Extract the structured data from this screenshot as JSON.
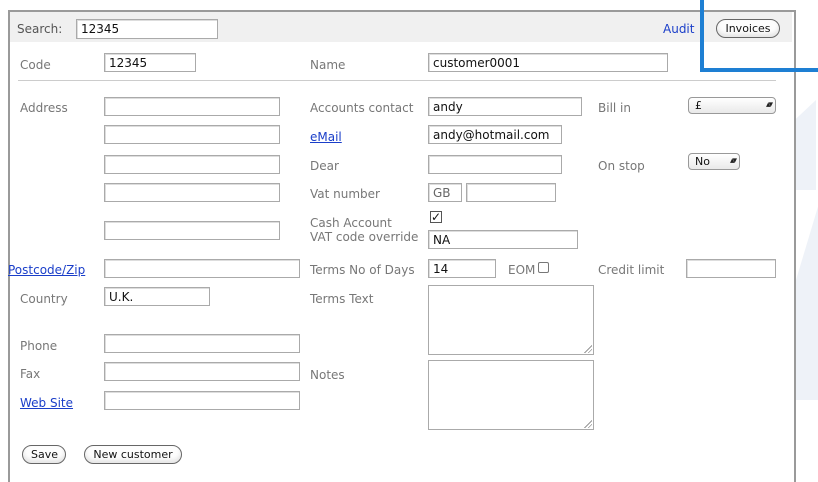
{
  "header": {
    "search_label": "Search:",
    "search_value": "12345",
    "audit_link": "Audit",
    "invoices_button": "Invoices"
  },
  "top": {
    "code_label": "Code",
    "code_value": "12345",
    "name_label": "Name",
    "name_value": "customer0001"
  },
  "left": {
    "address_label": "Address",
    "address_lines": [
      "",
      "",
      "",
      "",
      ""
    ],
    "postcode_link": "Postcode/Zip",
    "postcode_value": "",
    "country_label": "Country",
    "country_value": "U.K.",
    "phone_label": "Phone",
    "phone_value": "",
    "fax_label": "Fax",
    "fax_value": "",
    "website_link": "Web Site",
    "website_value": ""
  },
  "middle": {
    "accounts_contact_label": "Accounts contact",
    "accounts_contact_value": "andy",
    "email_link": "eMail",
    "email_value": "andy@hotmail.com",
    "dear_label": "Dear",
    "dear_value": "",
    "vat_number_label": "Vat number",
    "vat_prefix": "GB",
    "vat_value": "",
    "cash_account_label": "Cash Account",
    "cash_account_checked": true,
    "vat_override_label": "VAT code override",
    "vat_override_value": "NA",
    "terms_days_label": "Terms No of Days",
    "terms_days_value": "14",
    "eom_label": "EOM",
    "terms_text_label": "Terms Text",
    "terms_text_value": "",
    "notes_label": "Notes",
    "notes_value": ""
  },
  "right": {
    "bill_in_label": "Bill in",
    "bill_in_value": "£",
    "on_stop_label": "On stop",
    "on_stop_value": "No",
    "credit_limit_label": "Credit limit",
    "credit_limit_value": ""
  },
  "footer": {
    "save_button": "Save",
    "new_customer_button": "New customer"
  },
  "icons": {
    "select_arrows": "up-down-arrows-icon",
    "checkmark": "checkmark-icon",
    "resize_grip": "resize-grip-icon"
  },
  "colors": {
    "link": "#1a3ec9",
    "highlight_box": "#1e7fd3",
    "label": "#777777"
  }
}
